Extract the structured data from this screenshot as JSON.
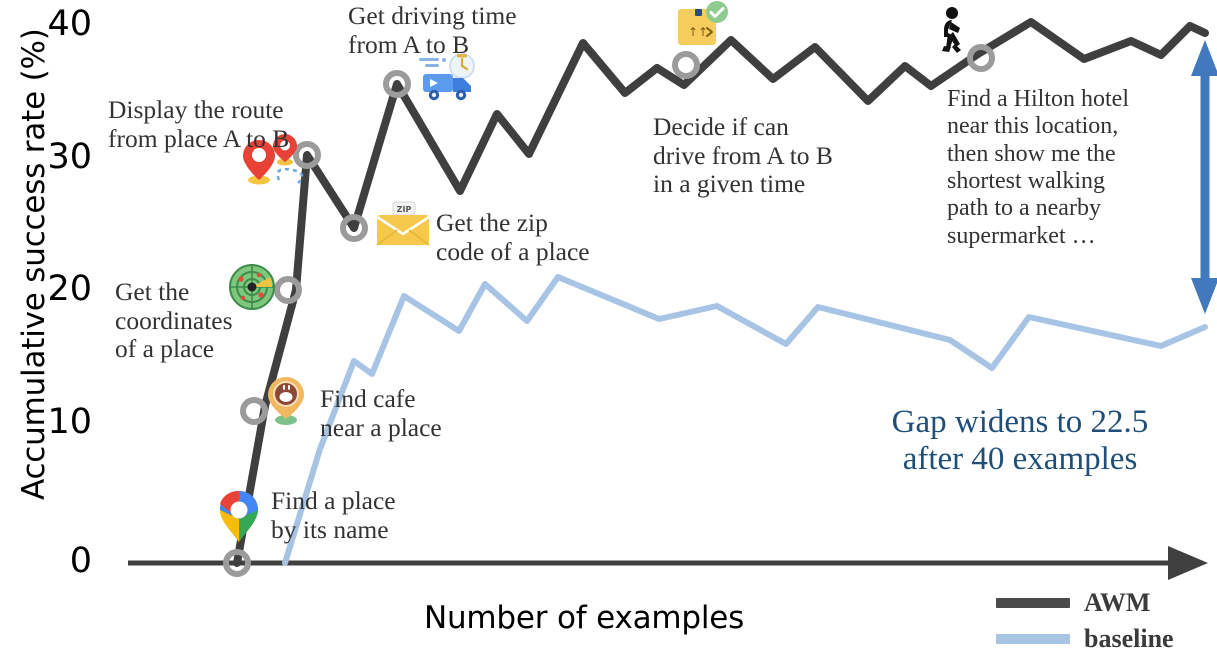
{
  "axes": {
    "ylabel": "Accumulative success rate (%)",
    "xlabel": "Number of examples",
    "yticks": [
      "0",
      "10",
      "20",
      "30",
      "40"
    ],
    "xticks": []
  },
  "legend": {
    "position": "bottom-right",
    "items": [
      {
        "label": "AWM",
        "color": "#4a4a4a"
      },
      {
        "label": "baseline",
        "color": "#a8c4e5"
      }
    ]
  },
  "gap_annotation": {
    "text": "Gap widens to 22.5\nafter 40 examples",
    "color": "#1f4e79",
    "arrow_color": "#4178be"
  },
  "annotations": [
    {
      "id": "find-place-by-name",
      "text": "Find a place\nby its name",
      "icon": "google-maps-pin-icon"
    },
    {
      "id": "find-cafe",
      "text": "Find cafe\nnear a place",
      "icon": "cafe-pin-icon"
    },
    {
      "id": "get-coordinates",
      "text": "Get the\ncoordinates\nof a place",
      "icon": "radar-target-icon"
    },
    {
      "id": "display-route",
      "text": "Display the route\nfrom place A to B",
      "icon": "route-pins-icon"
    },
    {
      "id": "get-zip-code",
      "text": "Get the zip\ncode of a place",
      "icon": "zip-envelope-icon"
    },
    {
      "id": "get-driving-time",
      "text": "Get driving time\nfrom A to B",
      "icon": "delivery-truck-icon"
    },
    {
      "id": "decide-drive-time",
      "text": "Decide if can\ndrive from A to B\nin a given time",
      "icon": "package-check-icon"
    },
    {
      "id": "find-hilton-hotel",
      "text": "Find a Hilton hotel\nnear this location,\nthen show me the\nshortest walking\npath to a nearby\nsupermarket …",
      "icon": "walking-person-icon"
    }
  ],
  "chart_data": {
    "type": "line",
    "title": "",
    "xlabel": "Number of examples",
    "ylabel": "Accumulative success rate (%)",
    "ylim": [
      0,
      41
    ],
    "xlim": [
      0,
      40
    ],
    "grid": false,
    "legend_position": "bottom-right",
    "yticks": [
      0,
      10,
      20,
      30,
      40
    ],
    "series": [
      {
        "name": "AWM",
        "color": "#4a4a4a",
        "points": [
          {
            "x": 0.0,
            "y": 0.0
          },
          {
            "x": 1.2,
            "y": 11.8
          },
          {
            "x": 2.4,
            "y": 20.6
          },
          {
            "x": 3.6,
            "y": 30.5
          },
          {
            "x": 4.8,
            "y": 25.0
          },
          {
            "x": 6.0,
            "y": 35.8
          },
          {
            "x": 8.4,
            "y": 27.7
          },
          {
            "x": 9.8,
            "y": 34.5
          },
          {
            "x": 11.0,
            "y": 31.5
          },
          {
            "x": 13.0,
            "y": 40.0
          },
          {
            "x": 14.6,
            "y": 36.2
          },
          {
            "x": 15.8,
            "y": 38.1
          },
          {
            "x": 16.8,
            "y": 36.8
          },
          {
            "x": 18.6,
            "y": 40.2
          },
          {
            "x": 20.2,
            "y": 37.2
          },
          {
            "x": 21.8,
            "y": 39.6
          },
          {
            "x": 23.8,
            "y": 35.5
          },
          {
            "x": 25.2,
            "y": 38.1
          },
          {
            "x": 26.2,
            "y": 36.6
          },
          {
            "x": 28.0,
            "y": 39.0
          },
          {
            "x": 30.0,
            "y": 41.0
          },
          {
            "x": 32.0,
            "y": 38.2
          },
          {
            "x": 33.8,
            "y": 39.6
          },
          {
            "x": 35.5,
            "y": 38.4
          },
          {
            "x": 37.5,
            "y": 40.6
          },
          {
            "x": 40.0,
            "y": 40.0
          }
        ]
      },
      {
        "name": "baseline",
        "color": "#a8c4e5",
        "points": [
          {
            "x": 3.8,
            "y": 0.0
          },
          {
            "x": 5.1,
            "y": 8.7
          },
          {
            "x": 6.4,
            "y": 15.4
          },
          {
            "x": 7.1,
            "y": 14.4
          },
          {
            "x": 8.3,
            "y": 20.3
          },
          {
            "x": 10.4,
            "y": 17.6
          },
          {
            "x": 11.4,
            "y": 21.2
          },
          {
            "x": 13.0,
            "y": 18.4
          },
          {
            "x": 14.2,
            "y": 21.8
          },
          {
            "x": 18.0,
            "y": 18.6
          },
          {
            "x": 20.2,
            "y": 19.6
          },
          {
            "x": 22.8,
            "y": 16.7
          },
          {
            "x": 24.0,
            "y": 19.5
          },
          {
            "x": 29.0,
            "y": 17.0
          },
          {
            "x": 30.6,
            "y": 14.9
          },
          {
            "x": 32.0,
            "y": 18.8
          },
          {
            "x": 37.0,
            "y": 16.6
          },
          {
            "x": 40.0,
            "y": 18.0
          }
        ]
      }
    ],
    "markers": [
      {
        "series": "AWM",
        "x": 0.0,
        "y": 0.0,
        "annotation": "find-place-by-name"
      },
      {
        "series": "AWM",
        "x": 1.2,
        "y": 11.8,
        "annotation": "find-cafe"
      },
      {
        "series": "AWM",
        "x": 2.4,
        "y": 20.6,
        "annotation": "get-coordinates"
      },
      {
        "series": "AWM",
        "x": 3.6,
        "y": 30.5,
        "annotation": "display-route"
      },
      {
        "series": "AWM",
        "x": 4.8,
        "y": 25.0,
        "annotation": "get-zip-code"
      },
      {
        "series": "AWM",
        "x": 6.0,
        "y": 35.8,
        "annotation": "get-driving-time"
      },
      {
        "series": "AWM",
        "x": 18.6,
        "y": 40.2,
        "annotation": "decide-drive-time"
      },
      {
        "series": "AWM",
        "x": 30.0,
        "y": 41.0,
        "annotation": "find-hilton-hotel"
      }
    ],
    "gap_arrow": {
      "x": 40.0,
      "y_top": 40.0,
      "y_bottom": 18.0,
      "label": "22.5"
    }
  }
}
